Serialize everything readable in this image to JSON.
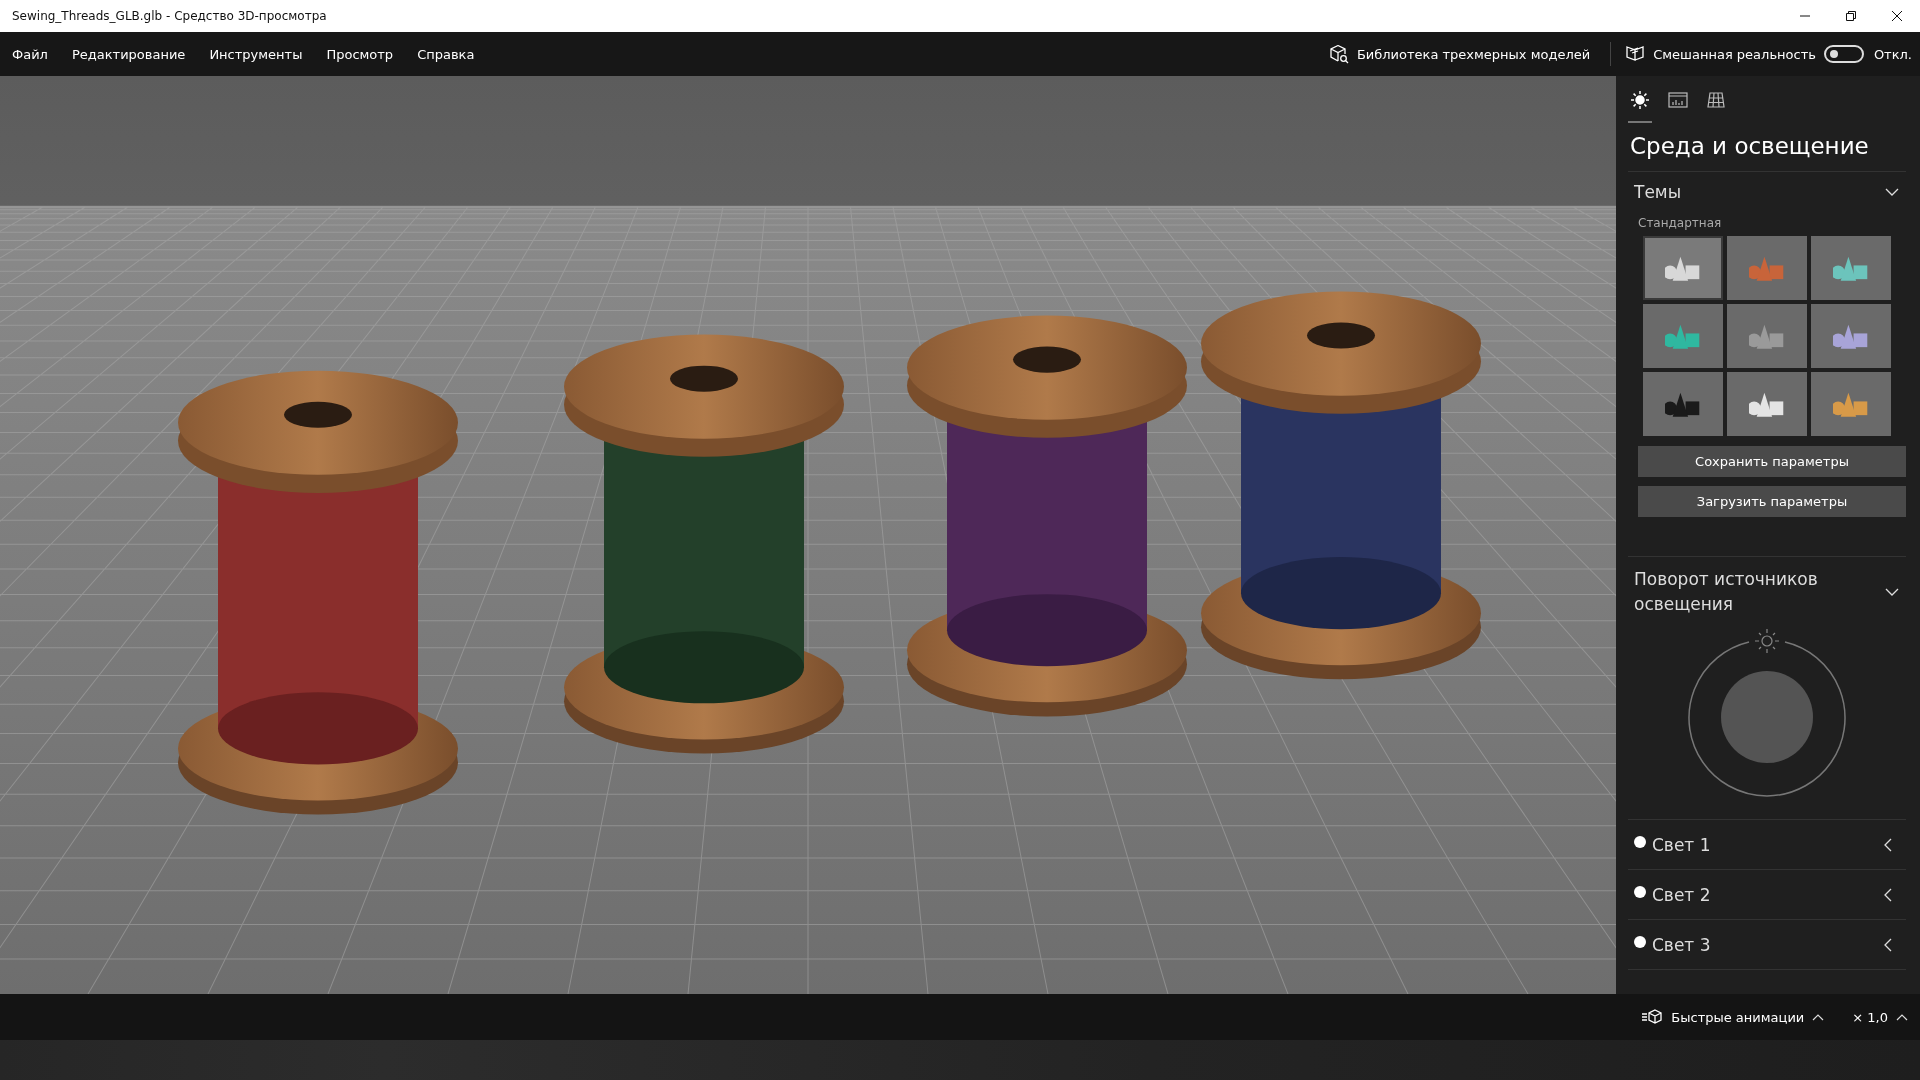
{
  "window": {
    "title": "Sewing_Threads_GLB.glb - Средство 3D-просмотра"
  },
  "menu": [
    "Файл",
    "Редактирование",
    "Инструменты",
    "Просмотр",
    "Справка"
  ],
  "toolbar": {
    "library_label": "Библиотека трехмерных моделей",
    "mixed_reality": {
      "label": "Смешанная реальность",
      "on": false,
      "state_text": "Откл."
    }
  },
  "panel": {
    "tabs": [
      {
        "kind": "sun",
        "selected": true
      },
      {
        "kind": "stats",
        "selected": false
      },
      {
        "kind": "grid",
        "selected": false
      }
    ],
    "title": "Среда и освещение",
    "themes": {
      "heading": "Темы",
      "expanded": true,
      "group_label": "Стандартная",
      "tiles": [
        {
          "color": "#d8d8d8",
          "selected": true
        },
        {
          "color": "#c8643a",
          "selected": false
        },
        {
          "color": "#6cc4bc",
          "selected": false
        },
        {
          "color": "#2fb8a0",
          "selected": false
        },
        {
          "color": "#9a9a9a",
          "selected": false
        },
        {
          "color": "#a8a4d8",
          "selected": false
        },
        {
          "color": "#1a1a1a",
          "selected": false
        },
        {
          "color": "#e4e4e4",
          "selected": false
        },
        {
          "color": "#d89a48",
          "selected": false
        }
      ],
      "buttons": [
        "Сохранить параметры",
        "Загрузить параметры"
      ]
    },
    "rotation": {
      "heading": "Поворот источников освещения",
      "expanded": true
    },
    "lights": [
      {
        "label": "Свет 1",
        "expanded": false
      },
      {
        "label": "Свет 2",
        "expanded": false
      },
      {
        "label": "Свет 3",
        "expanded": false
      }
    ]
  },
  "status_bar": {
    "animations_label": "Быстрые анимации",
    "speed": "× 1,0"
  }
}
